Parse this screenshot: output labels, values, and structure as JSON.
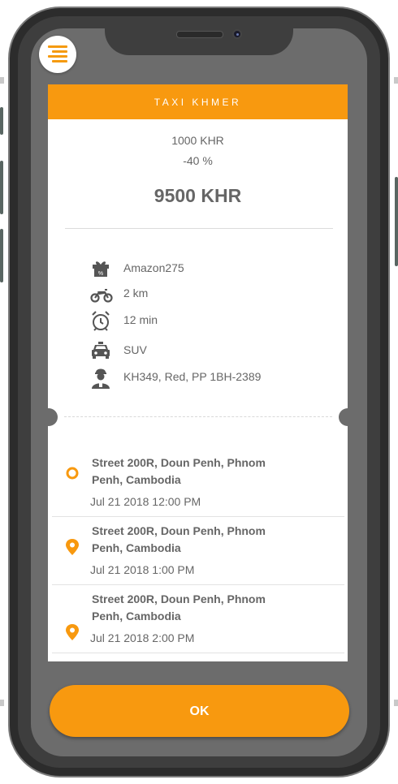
{
  "header": {
    "title": "TAXI KHMER"
  },
  "fare": {
    "original": "1000 KHR",
    "discount": "-40 %",
    "total": "9500 KHR"
  },
  "details": [
    {
      "icon": "gift-percent-icon",
      "text": "Amazon275"
    },
    {
      "icon": "motorbike-icon",
      "text": "2 km"
    },
    {
      "icon": "alarm-clock-icon",
      "text": "12 min"
    },
    {
      "icon": "car-icon",
      "text": "SUV"
    },
    {
      "icon": "driver-icon",
      "text": "KH349, Red, PP 1BH-2389"
    }
  ],
  "stops": [
    {
      "address": "Street 200R, Doun Penh, Phnom Penh, Cambodia",
      "time": "Jul 21 2018 12:00 PM",
      "marker": "circle"
    },
    {
      "address": "Street 200R, Doun Penh, Phnom Penh, Cambodia",
      "time": "Jul 21 2018 1:00 PM",
      "marker": "pin"
    },
    {
      "address": "Street 200R, Doun Penh, Phnom Penh, Cambodia",
      "time": "Jul 21 2018 2:00 PM",
      "marker": "pin"
    }
  ],
  "actions": {
    "ok_label": "OK"
  },
  "colors": {
    "accent": "#f8990f",
    "text": "#666666",
    "screen_bg": "#6c6c6c"
  }
}
